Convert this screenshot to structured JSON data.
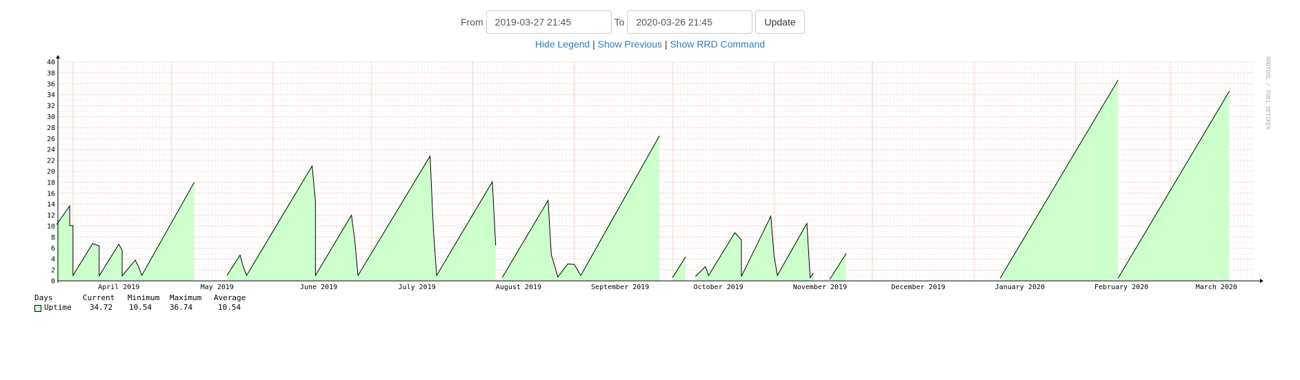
{
  "controls": {
    "from_label": "From",
    "from_value": "2019-03-27 21:45",
    "to_label": "To",
    "to_value": "2020-03-26 21:45",
    "update_label": "Update"
  },
  "links": {
    "hide_legend": "Hide Legend",
    "show_previous": "Show Previous",
    "show_rrd": "Show RRD Command",
    "sep": "|"
  },
  "watermark": "RRDTOOL / TOBI OETIKER",
  "colors": {
    "fill": "#ccffcc",
    "line": "#000000",
    "grid_minor": "#f0c8c8",
    "grid_major": "#f09090",
    "link": "#337ab7"
  },
  "legend": {
    "headers": {
      "unit": "Days",
      "current": "Current",
      "minimum": "Minimum",
      "maximum": "Maximum",
      "average": "Average"
    },
    "series_name": "Uptime",
    "current": "34.72",
    "minimum": "10.54",
    "maximum": "36.74",
    "average": "10.54"
  },
  "chart_data": {
    "type": "area",
    "x_start": "2019-03-27 21:45",
    "x_end": "2020-03-26 21:45",
    "y_range": [
      0,
      40
    ],
    "y_ticks": [
      0,
      2,
      4,
      6,
      8,
      10,
      12,
      14,
      16,
      18,
      20,
      22,
      24,
      26,
      28,
      30,
      32,
      34,
      36,
      38,
      40
    ],
    "x_labels": [
      {
        "date": "2019-04-15",
        "label": "April 2019"
      },
      {
        "date": "2019-05-15",
        "label": "May 2019"
      },
      {
        "date": "2019-06-15",
        "label": "June 2019"
      },
      {
        "date": "2019-07-15",
        "label": "July 2019"
      },
      {
        "date": "2019-08-15",
        "label": "August 2019"
      },
      {
        "date": "2019-09-15",
        "label": "September 2019"
      },
      {
        "date": "2019-10-15",
        "label": "October 2019"
      },
      {
        "date": "2019-11-15",
        "label": "November 2019"
      },
      {
        "date": "2019-12-15",
        "label": "December 2019"
      },
      {
        "date": "2020-01-15",
        "label": "January 2020"
      },
      {
        "date": "2020-02-15",
        "label": "February 2020"
      },
      {
        "date": "2020-03-15",
        "label": "March 2020"
      }
    ],
    "grid": true,
    "series": [
      {
        "name": "Uptime",
        "segments": [
          [
            [
              "2019-03-27",
              10.3
            ],
            [
              "2019-03-31",
              13.7
            ],
            [
              "2019-03-31",
              10.1
            ],
            [
              "2019-03-31",
              10.1
            ],
            [
              "2019-04-01",
              10.1
            ],
            [
              "2019-04-01",
              1.0
            ],
            [
              "2019-04-07",
              6.8
            ],
            [
              "2019-04-08",
              6.6
            ],
            [
              "2019-04-09",
              6.4
            ],
            [
              "2019-04-09",
              0.9
            ],
            [
              "2019-04-15",
              6.7
            ],
            [
              "2019-04-16",
              5.6
            ],
            [
              "2019-04-16",
              0.9
            ],
            [
              "2019-04-20",
              3.8
            ],
            [
              "2019-04-21",
              2.6
            ],
            [
              "2019-04-22",
              1.0
            ],
            [
              "2019-05-08",
              18.0
            ]
          ],
          [
            [
              "2019-05-18",
              1.0
            ],
            [
              "2019-05-22",
              4.7
            ],
            [
              "2019-05-23",
              2.5
            ],
            [
              "2019-05-24",
              1.0
            ],
            [
              "2019-06-13",
              21.0
            ],
            [
              "2019-06-14",
              14.5
            ],
            [
              "2019-06-14",
              1.0
            ],
            [
              "2019-06-25",
              12.0
            ],
            [
              "2019-06-26",
              7.5
            ],
            [
              "2019-06-27",
              1.0
            ],
            [
              "2019-07-19",
              22.8
            ],
            [
              "2019-07-20",
              9.5
            ],
            [
              "2019-07-21",
              1.0
            ],
            [
              "2019-08-07",
              18.1
            ],
            [
              "2019-08-08",
              6.5
            ]
          ],
          [
            [
              "2019-08-10",
              0.6
            ],
            [
              "2019-08-24",
              14.7
            ],
            [
              "2019-08-25",
              4.8
            ],
            [
              "2019-08-27",
              0.7
            ],
            [
              "2019-08-30",
              3.1
            ],
            [
              "2019-09-01",
              3.0
            ],
            [
              "2019-09-03",
              1.0
            ],
            [
              "2019-09-27",
              26.5
            ]
          ],
          [
            [
              "2019-10-01",
              0.6
            ],
            [
              "2019-10-05",
              4.4
            ]
          ],
          [
            [
              "2019-10-08",
              0.8
            ],
            [
              "2019-10-11",
              2.6
            ],
            [
              "2019-10-12",
              1.0
            ],
            [
              "2019-10-20",
              8.8
            ],
            [
              "2019-10-22",
              7.5
            ],
            [
              "2019-10-22",
              0.8
            ],
            [
              "2019-10-31",
              11.8
            ],
            [
              "2019-11-01",
              4.5
            ],
            [
              "2019-11-02",
              1.0
            ],
            [
              "2019-11-11",
              10.5
            ],
            [
              "2019-11-12",
              0.6
            ],
            [
              "2019-11-13",
              1.4
            ]
          ],
          [
            [
              "2019-11-18",
              0.3
            ],
            [
              "2019-11-23",
              5.0
            ]
          ],
          [
            [
              "2020-01-09",
              0.5
            ],
            [
              "2020-02-14",
              36.7
            ]
          ],
          [
            [
              "2020-02-14",
              0.5
            ],
            [
              "2020-03-19",
              34.7
            ]
          ]
        ]
      }
    ]
  }
}
